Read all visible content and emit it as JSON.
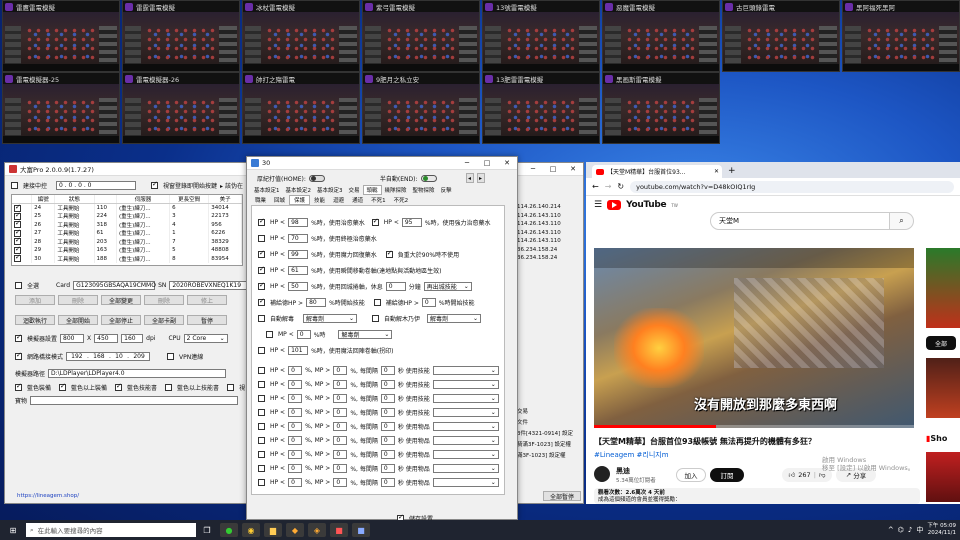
{
  "tiles": [
    {
      "label": "雷鷹雷電模擬"
    },
    {
      "label": "雷霆雷電模擬"
    },
    {
      "label": "冰杖雷電模擬"
    },
    {
      "label": "紫弓雷電模擬"
    },
    {
      "label": "13號雷電模擬"
    },
    {
      "label": "惡魔雷電模擬"
    },
    {
      "label": "古巨頭錄雷電"
    },
    {
      "label": "黑阿福死黑阿"
    },
    {
      "label": "雷電模擬器-25"
    },
    {
      "label": "雷電模擬器-26"
    },
    {
      "label": "帥打之殤雷電"
    },
    {
      "label": "9肥月之私立安"
    },
    {
      "label": "13肥雷雷電模擬"
    },
    {
      "label": "黑画斯雷電模擬"
    }
  ],
  "main": {
    "title": "大富Pro 2.0.0.9(1.7.27)",
    "connect_label": "建接中控",
    "ip": "0 . 0 . 0 . 0",
    "window_label": "視窗登錄即開始按鍵",
    "extra": "▸ 該伪在",
    "columns": [
      "編號",
      "狀態",
      "伺服器",
      "更長空間",
      "美子"
    ],
    "rows": [
      {
        "id": "24",
        "status": "工具開始",
        "a": "110",
        "srv": "(重生)練刀...",
        "n": "6",
        "v": "34014",
        "ip": "114.26.140.214"
      },
      {
        "id": "25",
        "status": "工具開始",
        "a": "224",
        "srv": "(重生)練刀...",
        "n": "3",
        "v": "22173",
        "ip": "114.26.143.110"
      },
      {
        "id": "26",
        "status": "工具開始",
        "a": "318",
        "srv": "(重生)練刀...",
        "n": "4",
        "v": "956",
        "ip": "114.26.143.110"
      },
      {
        "id": "27",
        "status": "工具開始",
        "a": "61",
        "srv": "(重生)練刀...",
        "n": "1",
        "v": "6226",
        "ip": "114.26.143.110"
      },
      {
        "id": "28",
        "status": "工具開始",
        "a": "203",
        "srv": "(重生)練刀...",
        "n": "7",
        "v": "38329",
        "ip": "114.26.143.110"
      },
      {
        "id": "29",
        "status": "工具開始",
        "a": "163",
        "srv": "(重生)練刀...",
        "n": "5",
        "v": "48808",
        "ip": "36.234.158.24"
      },
      {
        "id": "30",
        "status": "工具開始",
        "a": "188",
        "srv": "(重生)練刀...",
        "n": "8",
        "v": "83954",
        "ip": "36.234.158.24"
      }
    ],
    "select_all": "全選",
    "card_label": "Card",
    "card_value": "G123095GBSAQA19CMMO",
    "sn_label": "SN",
    "sn_value": "2020ROBEVXNEQ1K19",
    "sn_extra": "應",
    "btn_row1": [
      "添加",
      "刪除",
      "全部變更",
      "刪除",
      "修上"
    ],
    "btn_row2": [
      "迴歡執行",
      "全部開始",
      "全部停止",
      "全部卡副",
      "暫停"
    ],
    "res_label": "模擬器設置",
    "res_w": "800",
    "res_x": "X",
    "res_h": "450",
    "res_dpi": "160",
    "dpi": "dpi",
    "cpu_label": "CPU",
    "cpu_value": "2 Core",
    "net_label": "網路橋接模式",
    "ip1": "192",
    "ip2": "168",
    "ip3": "10",
    "ip4": "209",
    "vpn": "VPN連線",
    "path_label": "模擬器路徑",
    "path_value": "D:\\LDPlayer\\LDPlayer4.0",
    "chk_a": "藍色裝備",
    "chk_b": "藍色以上裝備",
    "chk_c": "藍色技能書",
    "chk_d": "藍色以上技能書",
    "chk_e": "視",
    "item_label": "寶物",
    "link": "https://lineagem.shop/",
    "log": [
      "交易",
      "文件",
      "3件[4321-0914] 設定",
      "騎滿3F-1023] 設定權",
      "滿3F-1023] 設定權"
    ],
    "all_apply": "全部暫停"
  },
  "dialog": {
    "title": "30",
    "home_label": "厚紀打值(HOME):",
    "end_label": "半自動(END):",
    "tabs1": [
      "基本設定1",
      "基本設定2",
      "基本設定3",
      "交易",
      "頭戰",
      "幾隊探險",
      "聖物探險",
      "反擊"
    ],
    "tabs2": [
      "職業",
      "回城",
      "保護",
      "技能",
      "迴避",
      "通道",
      "不死1",
      "不死2"
    ],
    "all_label": "全部套用全職業",
    "hp1": "98",
    "hp1_pct": "%時，使用治愈藥水",
    "hp2": "95",
    "hp2_pct": "%時，使用強力治愈藥水",
    "hp3": "70",
    "hp3_pct": "%時，使用終極治愈藥水",
    "hp4": "99",
    "hp4_pct": "%時，使用魔力回復藥水",
    "hp4_extra": "負重大於90%時不使用",
    "hp5": "61",
    "hp5_pct": "%時，使用瞬間移動卷軸(達地點與活動地區生效)",
    "hp6": "50",
    "hp6_pct": "%時，使用回城捲軸，休息",
    "hp6_min": "0",
    "hp6_unit": "分鐘",
    "hp6_sel": "再出城技能",
    "aux1": "補給德HP >",
    "aux1_v": "80",
    "aux1_t": "%時開始技能",
    "aux2": "補給德HP >",
    "aux2_v": "0",
    "aux2_t": "%時開始技能",
    "auto1": "自動解毒",
    "auto1_sel": "解毒劑",
    "auto2": "自動解木乃伊",
    "auto2_sel": "解毒劑",
    "mp_label": "MP <",
    "mp_v": "0",
    "mp_t": "%時",
    "mp_sel": "解毒劑",
    "hp7": "101",
    "hp7_pct": "%時，使用魔法回陣卷軸(拐印)",
    "combo_rows": [
      {
        "hp": "0",
        "mp": "0",
        "sec": "0",
        "txt": "秒 使用技能"
      },
      {
        "hp": "0",
        "mp": "0",
        "sec": "0",
        "txt": "秒 使用技能"
      },
      {
        "hp": "0",
        "mp": "0",
        "sec": "0",
        "txt": "秒 使用技能"
      },
      {
        "hp": "0",
        "mp": "0",
        "sec": "0",
        "txt": "秒 使用技能"
      },
      {
        "hp": "0",
        "mp": "0",
        "sec": "0",
        "txt": "秒 使用物品"
      },
      {
        "hp": "0",
        "mp": "0",
        "sec": "0",
        "txt": "秒 使用物品"
      },
      {
        "hp": "0",
        "mp": "0",
        "sec": "0",
        "txt": "秒 使用物品"
      },
      {
        "hp": "0",
        "mp": "0",
        "sec": "0",
        "txt": "秒 使用物品"
      },
      {
        "hp": "0",
        "mp": "0",
        "sec": "0",
        "txt": "秒 使用物品"
      }
    ],
    "hp_word": "HP <",
    "hp_pct_word": "%, MP >",
    "mp_pct_word": "%, 每間隔",
    "save": "儲存設置"
  },
  "browser": {
    "tab_title": "【天堂M精華】台服首位93...",
    "url": "youtube.com/watch?v=D48kOIQ1rIg",
    "yt": "YouTube",
    "yt_sup": "TW",
    "search_value": "天堂M",
    "overlay": "沒有開放到那麼多東西啊",
    "video_title": "【天堂M精華】台服首位93級帳號 無法再提升的機體有多狂？",
    "hashtags": "#Lineagem #리니지m",
    "channel": "黑迪",
    "subs": "5.34萬位訂閱者",
    "join": "加入",
    "subscribe": "訂閱",
    "likes": "267",
    "share": "分享",
    "views": "觀看次數：2.6萬次  4 天前",
    "desc": "成為這個頻道的會員並獲得獎勵：",
    "side_chip": "全部",
    "side_text": "Sho",
    "watermark": "啟用 Windows\n移至 [設定] 以啟用 Windows。"
  },
  "taskbar": {
    "search": "在此輸入要搜尋的內容",
    "time": "下午 05:09",
    "date": "2024/11/1"
  }
}
